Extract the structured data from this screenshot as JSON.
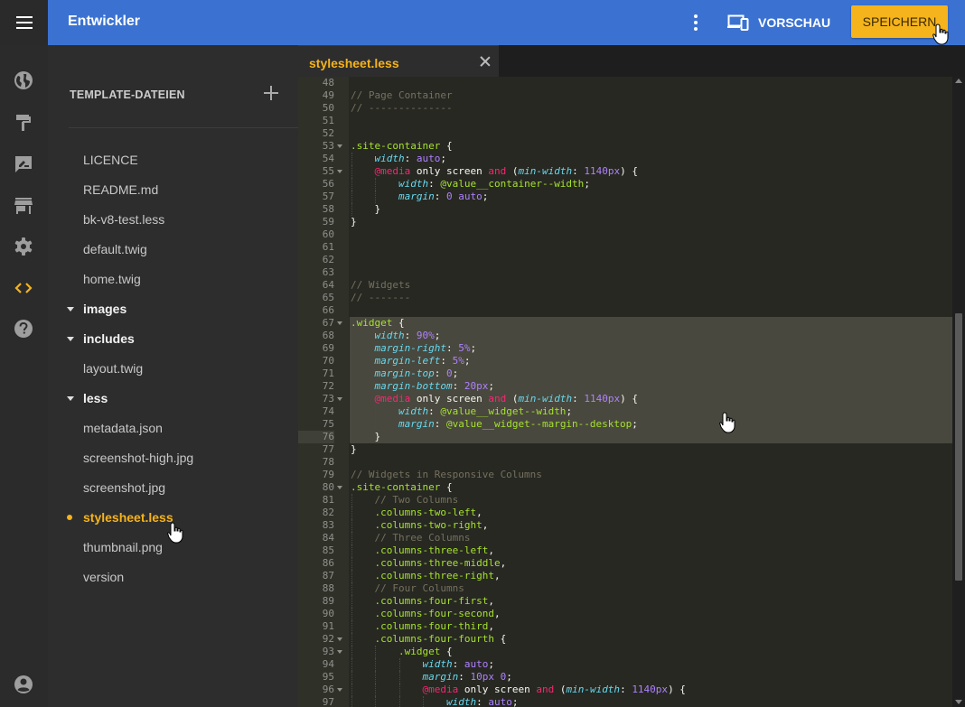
{
  "header": {
    "title": "Entwickler",
    "preview_label": "VORSCHAU",
    "save_label": "SPEICHERN",
    "accent_color": "#3b72d1",
    "save_color": "#f5b31c"
  },
  "rail": {
    "items": [
      {
        "icon": "globe-icon"
      },
      {
        "icon": "paint-roller-icon"
      },
      {
        "icon": "feedback-icon"
      },
      {
        "icon": "store-icon"
      },
      {
        "icon": "gear-icon"
      },
      {
        "icon": "code-icon",
        "active": true
      },
      {
        "icon": "help-icon"
      },
      {
        "icon": "account-icon"
      }
    ]
  },
  "files": {
    "header": "TEMPLATE-DATEIEN",
    "items": [
      {
        "label": "LICENCE",
        "type": "file"
      },
      {
        "label": "README.md",
        "type": "file"
      },
      {
        "label": "bk-v8-test.less",
        "type": "file"
      },
      {
        "label": "default.twig",
        "type": "file"
      },
      {
        "label": "home.twig",
        "type": "file"
      },
      {
        "label": "images",
        "type": "folder"
      },
      {
        "label": "includes",
        "type": "folder"
      },
      {
        "label": "layout.twig",
        "type": "file"
      },
      {
        "label": "less",
        "type": "folder"
      },
      {
        "label": "metadata.json",
        "type": "file"
      },
      {
        "label": "screenshot-high.jpg",
        "type": "file"
      },
      {
        "label": "screenshot.jpg",
        "type": "file"
      },
      {
        "label": "stylesheet.less",
        "type": "file",
        "active": true
      },
      {
        "label": "thumbnail.png",
        "type": "file"
      },
      {
        "label": "version",
        "type": "file"
      }
    ]
  },
  "editor": {
    "tab_label": "stylesheet.less",
    "lines": [
      {
        "n": "48",
        "parts": []
      },
      {
        "n": "49",
        "parts": [
          [
            "c-com",
            "// Page Container"
          ]
        ]
      },
      {
        "n": "50",
        "parts": [
          [
            "c-com",
            "// --------------"
          ]
        ]
      },
      {
        "n": "51",
        "parts": []
      },
      {
        "n": "52",
        "parts": []
      },
      {
        "n": "53",
        "fold": true,
        "parts": [
          [
            "c-sel",
            ".site-container"
          ],
          [
            "c-plain",
            " {"
          ]
        ]
      },
      {
        "n": "54",
        "indent": 1,
        "parts": [
          [
            "c-plain",
            "    "
          ],
          [
            "c-prop",
            "width"
          ],
          [
            "c-plain",
            ": "
          ],
          [
            "c-num",
            "auto"
          ],
          [
            "c-plain",
            ";"
          ]
        ]
      },
      {
        "n": "55",
        "indent": 1,
        "fold": true,
        "parts": [
          [
            "c-plain",
            "    "
          ],
          [
            "c-kw",
            "@media"
          ],
          [
            "c-plain",
            " only screen "
          ],
          [
            "c-kw",
            "and"
          ],
          [
            "c-plain",
            " ("
          ],
          [
            "c-prop",
            "min-width"
          ],
          [
            "c-plain",
            ": "
          ],
          [
            "c-num",
            "1140px"
          ],
          [
            "c-plain",
            ") {"
          ]
        ]
      },
      {
        "n": "56",
        "indent": 2,
        "parts": [
          [
            "c-plain",
            "        "
          ],
          [
            "c-prop",
            "width"
          ],
          [
            "c-plain",
            ": "
          ],
          [
            "c-var",
            "@value__container--width"
          ],
          [
            "c-plain",
            ";"
          ]
        ]
      },
      {
        "n": "57",
        "indent": 2,
        "parts": [
          [
            "c-plain",
            "        "
          ],
          [
            "c-prop",
            "margin"
          ],
          [
            "c-plain",
            ": "
          ],
          [
            "c-num",
            "0"
          ],
          [
            "c-plain",
            " "
          ],
          [
            "c-num",
            "auto"
          ],
          [
            "c-plain",
            ";"
          ]
        ]
      },
      {
        "n": "58",
        "indent": 1,
        "parts": [
          [
            "c-plain",
            "    }"
          ]
        ]
      },
      {
        "n": "59",
        "parts": [
          [
            "c-plain",
            "}"
          ]
        ]
      },
      {
        "n": "60",
        "parts": []
      },
      {
        "n": "61",
        "parts": []
      },
      {
        "n": "62",
        "parts": []
      },
      {
        "n": "63",
        "parts": []
      },
      {
        "n": "64",
        "parts": [
          [
            "c-com",
            "// Widgets"
          ]
        ]
      },
      {
        "n": "65",
        "parts": [
          [
            "c-com",
            "// -------"
          ]
        ]
      },
      {
        "n": "66",
        "parts": []
      },
      {
        "n": "67",
        "fold": true,
        "hl": true,
        "parts": [
          [
            "c-sel",
            ".widget"
          ],
          [
            "c-plain",
            " {"
          ]
        ]
      },
      {
        "n": "68",
        "indent": 1,
        "hl": true,
        "parts": [
          [
            "c-plain",
            "    "
          ],
          [
            "c-prop",
            "width"
          ],
          [
            "c-plain",
            ": "
          ],
          [
            "c-num",
            "90%"
          ],
          [
            "c-plain",
            ";"
          ]
        ]
      },
      {
        "n": "69",
        "indent": 1,
        "hl": true,
        "parts": [
          [
            "c-plain",
            "    "
          ],
          [
            "c-prop",
            "margin-right"
          ],
          [
            "c-plain",
            ": "
          ],
          [
            "c-num",
            "5%"
          ],
          [
            "c-plain",
            ";"
          ]
        ]
      },
      {
        "n": "70",
        "indent": 1,
        "hl": true,
        "parts": [
          [
            "c-plain",
            "    "
          ],
          [
            "c-prop",
            "margin-left"
          ],
          [
            "c-plain",
            ": "
          ],
          [
            "c-num",
            "5%"
          ],
          [
            "c-plain",
            ";"
          ]
        ]
      },
      {
        "n": "71",
        "indent": 1,
        "hl": true,
        "parts": [
          [
            "c-plain",
            "    "
          ],
          [
            "c-prop",
            "margin-top"
          ],
          [
            "c-plain",
            ": "
          ],
          [
            "c-num",
            "0"
          ],
          [
            "c-plain",
            ";"
          ]
        ]
      },
      {
        "n": "72",
        "indent": 1,
        "hl": true,
        "parts": [
          [
            "c-plain",
            "    "
          ],
          [
            "c-prop",
            "margin-bottom"
          ],
          [
            "c-plain",
            ": "
          ],
          [
            "c-num",
            "20px"
          ],
          [
            "c-plain",
            ";"
          ]
        ]
      },
      {
        "n": "73",
        "indent": 1,
        "fold": true,
        "hl": true,
        "parts": [
          [
            "c-plain",
            "    "
          ],
          [
            "c-kw",
            "@media"
          ],
          [
            "c-plain",
            " only screen "
          ],
          [
            "c-kw",
            "and"
          ],
          [
            "c-plain",
            " ("
          ],
          [
            "c-prop",
            "min-width"
          ],
          [
            "c-plain",
            ": "
          ],
          [
            "c-num",
            "1140px"
          ],
          [
            "c-plain",
            ") {"
          ]
        ]
      },
      {
        "n": "74",
        "indent": 2,
        "hl": true,
        "parts": [
          [
            "c-plain",
            "        "
          ],
          [
            "c-prop",
            "width"
          ],
          [
            "c-plain",
            ": "
          ],
          [
            "c-var",
            "@value__widget--width"
          ],
          [
            "c-plain",
            ";"
          ]
        ]
      },
      {
        "n": "75",
        "indent": 2,
        "hl": true,
        "parts": [
          [
            "c-plain",
            "        "
          ],
          [
            "c-prop",
            "margin"
          ],
          [
            "c-plain",
            ": "
          ],
          [
            "c-var",
            "@value__widget--margin--desktop"
          ],
          [
            "c-plain",
            ";"
          ]
        ]
      },
      {
        "n": "76",
        "indent": 1,
        "hl": true,
        "cur": true,
        "parts": [
          [
            "c-plain",
            "    }"
          ]
        ]
      },
      {
        "n": "77",
        "parts": [
          [
            "c-plain",
            "}"
          ]
        ]
      },
      {
        "n": "78",
        "parts": []
      },
      {
        "n": "79",
        "parts": [
          [
            "c-com",
            "// Widgets in Responsive Columns"
          ]
        ]
      },
      {
        "n": "80",
        "fold": true,
        "parts": [
          [
            "c-sel",
            ".site-container"
          ],
          [
            "c-plain",
            " {"
          ]
        ]
      },
      {
        "n": "81",
        "indent": 1,
        "parts": [
          [
            "c-plain",
            "    "
          ],
          [
            "c-com",
            "// Two Columns"
          ]
        ]
      },
      {
        "n": "82",
        "indent": 1,
        "parts": [
          [
            "c-plain",
            "    "
          ],
          [
            "c-sel",
            ".columns-two-left"
          ],
          [
            "c-plain",
            ","
          ]
        ]
      },
      {
        "n": "83",
        "indent": 1,
        "parts": [
          [
            "c-plain",
            "    "
          ],
          [
            "c-sel",
            ".columns-two-right"
          ],
          [
            "c-plain",
            ","
          ]
        ]
      },
      {
        "n": "84",
        "indent": 1,
        "parts": [
          [
            "c-plain",
            "    "
          ],
          [
            "c-com",
            "// Three Columns"
          ]
        ]
      },
      {
        "n": "85",
        "indent": 1,
        "parts": [
          [
            "c-plain",
            "    "
          ],
          [
            "c-sel",
            ".columns-three-left"
          ],
          [
            "c-plain",
            ","
          ]
        ]
      },
      {
        "n": "86",
        "indent": 1,
        "parts": [
          [
            "c-plain",
            "    "
          ],
          [
            "c-sel",
            ".columns-three-middle"
          ],
          [
            "c-plain",
            ","
          ]
        ]
      },
      {
        "n": "87",
        "indent": 1,
        "parts": [
          [
            "c-plain",
            "    "
          ],
          [
            "c-sel",
            ".columns-three-right"
          ],
          [
            "c-plain",
            ","
          ]
        ]
      },
      {
        "n": "88",
        "indent": 1,
        "parts": [
          [
            "c-plain",
            "    "
          ],
          [
            "c-com",
            "// Four Columns"
          ]
        ]
      },
      {
        "n": "89",
        "indent": 1,
        "parts": [
          [
            "c-plain",
            "    "
          ],
          [
            "c-sel",
            ".columns-four-first"
          ],
          [
            "c-plain",
            ","
          ]
        ]
      },
      {
        "n": "90",
        "indent": 1,
        "parts": [
          [
            "c-plain",
            "    "
          ],
          [
            "c-sel",
            ".columns-four-second"
          ],
          [
            "c-plain",
            ","
          ]
        ]
      },
      {
        "n": "91",
        "indent": 1,
        "parts": [
          [
            "c-plain",
            "    "
          ],
          [
            "c-sel",
            ".columns-four-third"
          ],
          [
            "c-plain",
            ","
          ]
        ]
      },
      {
        "n": "92",
        "indent": 1,
        "fold": true,
        "parts": [
          [
            "c-plain",
            "    "
          ],
          [
            "c-sel",
            ".columns-four-fourth"
          ],
          [
            "c-plain",
            " {"
          ]
        ]
      },
      {
        "n": "93",
        "indent": 2,
        "fold": true,
        "parts": [
          [
            "c-plain",
            "        "
          ],
          [
            "c-sel",
            ".widget"
          ],
          [
            "c-plain",
            " {"
          ]
        ]
      },
      {
        "n": "94",
        "indent": 3,
        "parts": [
          [
            "c-plain",
            "            "
          ],
          [
            "c-prop",
            "width"
          ],
          [
            "c-plain",
            ": "
          ],
          [
            "c-num",
            "auto"
          ],
          [
            "c-plain",
            ";"
          ]
        ]
      },
      {
        "n": "95",
        "indent": 3,
        "parts": [
          [
            "c-plain",
            "            "
          ],
          [
            "c-prop",
            "margin"
          ],
          [
            "c-plain",
            ": "
          ],
          [
            "c-num",
            "10px"
          ],
          [
            "c-plain",
            " "
          ],
          [
            "c-num",
            "0"
          ],
          [
            "c-plain",
            ";"
          ]
        ]
      },
      {
        "n": "96",
        "indent": 3,
        "fold": true,
        "parts": [
          [
            "c-plain",
            "            "
          ],
          [
            "c-kw",
            "@media"
          ],
          [
            "c-plain",
            " only screen "
          ],
          [
            "c-kw",
            "and"
          ],
          [
            "c-plain",
            " ("
          ],
          [
            "c-prop",
            "min-width"
          ],
          [
            "c-plain",
            ": "
          ],
          [
            "c-num",
            "1140px"
          ],
          [
            "c-plain",
            ") {"
          ]
        ]
      },
      {
        "n": "97",
        "indent": 4,
        "parts": [
          [
            "c-plain",
            "                "
          ],
          [
            "c-prop",
            "width"
          ],
          [
            "c-plain",
            ": "
          ],
          [
            "c-num",
            "auto"
          ],
          [
            "c-plain",
            ";"
          ]
        ]
      }
    ]
  }
}
